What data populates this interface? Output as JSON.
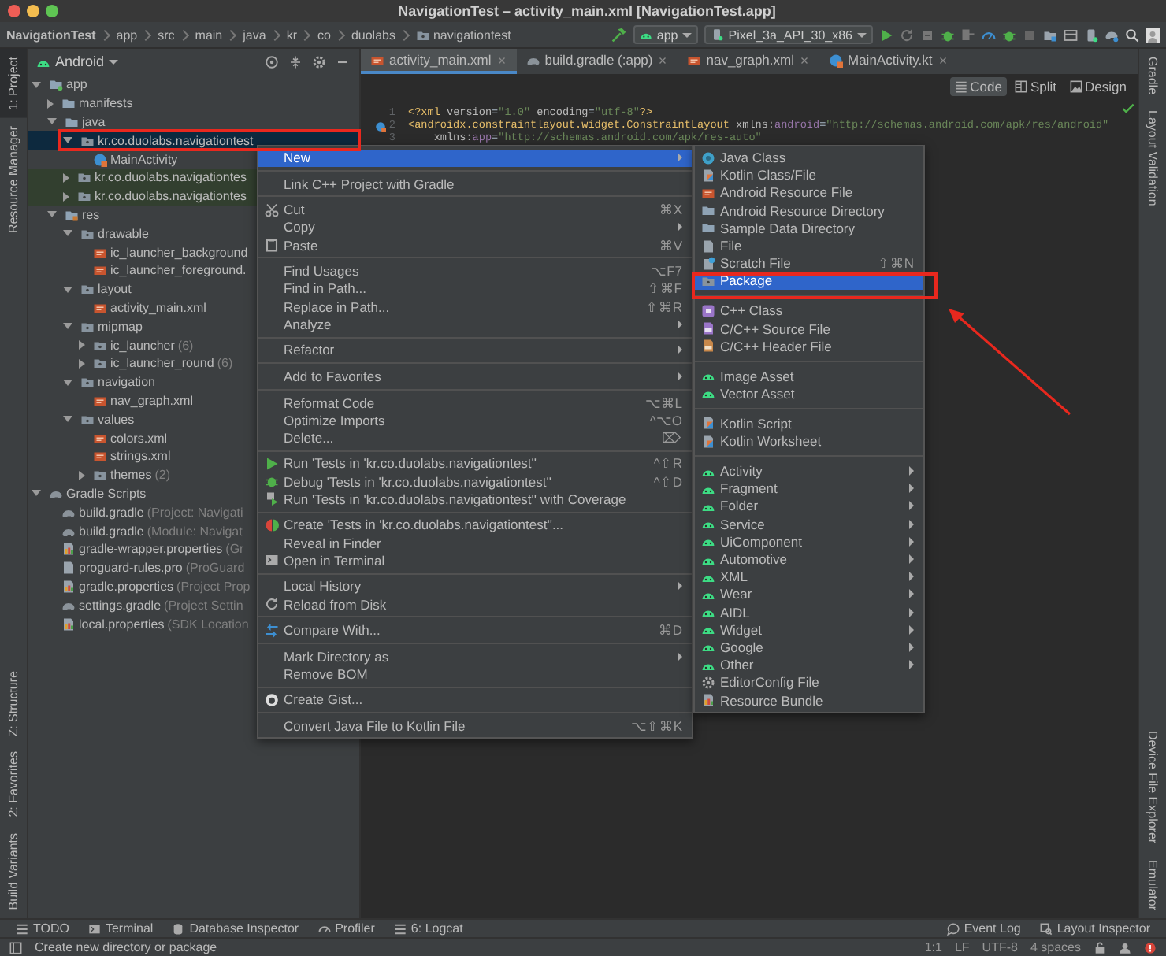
{
  "window": {
    "title": "NavigationTest – activity_main.xml [NavigationTest.app]"
  },
  "breadcrumbs": [
    {
      "label": "NavigationTest",
      "kind": "project"
    },
    {
      "label": "app",
      "kind": "plain"
    },
    {
      "label": "src",
      "kind": "plain"
    },
    {
      "label": "main",
      "kind": "plain"
    },
    {
      "label": "java",
      "kind": "plain"
    },
    {
      "label": "kr",
      "kind": "plain"
    },
    {
      "label": "co",
      "kind": "plain"
    },
    {
      "label": "duolabs",
      "kind": "plain"
    },
    {
      "label": "navigationtest",
      "kind": "folder"
    }
  ],
  "run_config": {
    "module": "app",
    "device": "Pixel_3a_API_30_x86"
  },
  "left_tool_tabs": {
    "top": [
      {
        "label": "1: Project",
        "selected": true
      },
      {
        "label": "Resource Manager",
        "selected": false
      }
    ],
    "bottom": [
      {
        "label": "Z: Structure",
        "selected": false
      },
      {
        "label": "2: Favorites",
        "selected": false
      },
      {
        "label": "Build Variants",
        "selected": false
      }
    ]
  },
  "right_tool_tabs": {
    "top": [
      {
        "label": "Gradle"
      },
      {
        "label": "Layout Validation"
      }
    ],
    "bottom": [
      {
        "label": "Device File Explorer"
      },
      {
        "label": "Emulator"
      }
    ]
  },
  "project_panel": {
    "view": "Android",
    "tree": [
      {
        "label": "app",
        "kind": "module",
        "expanded": true,
        "selected": false,
        "children": [
          {
            "label": "manifests",
            "kind": "folder",
            "expanded": false,
            "selected": false
          },
          {
            "label": "java",
            "kind": "folder",
            "expanded": true,
            "selected": false,
            "children": [
              {
                "label": "kr.co.duolabs.navigationtest",
                "kind": "package",
                "expanded": true,
                "selected": true,
                "outlined": true,
                "children": [
                  {
                    "label": "MainActivity",
                    "kind": "kotlin-class",
                    "selected": false
                  }
                ]
              },
              {
                "label": "kr.co.duolabs.navigationtes",
                "kind": "test-package",
                "expanded": false,
                "selected": false
              },
              {
                "label": "kr.co.duolabs.navigationtes",
                "kind": "test-package",
                "expanded": false,
                "selected": false
              }
            ]
          },
          {
            "label": "res",
            "kind": "res",
            "expanded": true,
            "selected": false,
            "children": [
              {
                "label": "drawable",
                "kind": "package",
                "expanded": true,
                "selected": false,
                "children": [
                  {
                    "label": "ic_launcher_background",
                    "kind": "xml",
                    "selected": false
                  },
                  {
                    "label": "ic_launcher_foreground.",
                    "kind": "xml",
                    "selected": false
                  }
                ]
              },
              {
                "label": "layout",
                "kind": "package",
                "expanded": true,
                "selected": false,
                "children": [
                  {
                    "label": "activity_main.xml",
                    "kind": "xml",
                    "selected": false
                  }
                ]
              },
              {
                "label": "mipmap",
                "kind": "package",
                "expanded": true,
                "selected": false,
                "children": [
                  {
                    "label": "ic_launcher",
                    "hint": "(6)",
                    "kind": "package",
                    "expanded": false,
                    "selected": false
                  },
                  {
                    "label": "ic_launcher_round",
                    "hint": "(6)",
                    "kind": "package",
                    "expanded": false,
                    "selected": false
                  }
                ]
              },
              {
                "label": "navigation",
                "kind": "package",
                "expanded": true,
                "selected": false,
                "children": [
                  {
                    "label": "nav_graph.xml",
                    "kind": "xml",
                    "selected": false
                  }
                ]
              },
              {
                "label": "values",
                "kind": "package",
                "expanded": true,
                "selected": false,
                "children": [
                  {
                    "label": "colors.xml",
                    "kind": "xml",
                    "selected": false
                  },
                  {
                    "label": "strings.xml",
                    "kind": "xml",
                    "selected": false
                  },
                  {
                    "label": "themes",
                    "hint": "(2)",
                    "kind": "package",
                    "expanded": false,
                    "selected": false
                  }
                ]
              }
            ]
          }
        ]
      },
      {
        "label": "Gradle Scripts",
        "kind": "gradle",
        "expanded": true,
        "selected": false,
        "children": [
          {
            "label": "build.gradle",
            "hint": "(Project: Navigati",
            "kind": "gradle",
            "selected": false
          },
          {
            "label": "build.gradle",
            "hint": "(Module: Navigat",
            "kind": "gradle",
            "selected": false
          },
          {
            "label": "gradle-wrapper.properties",
            "hint": "(Gr",
            "kind": "properties",
            "selected": false
          },
          {
            "label": "proguard-rules.pro",
            "hint": "(ProGuard",
            "kind": "file",
            "selected": false
          },
          {
            "label": "gradle.properties",
            "hint": "(Project Prop",
            "kind": "properties",
            "selected": false
          },
          {
            "label": "settings.gradle",
            "hint": "(Project Settin",
            "kind": "gradle",
            "selected": false
          },
          {
            "label": "local.properties",
            "hint": "(SDK Location",
            "kind": "properties",
            "selected": false
          }
        ]
      }
    ]
  },
  "editor": {
    "tabs": [
      {
        "label": "activity_main.xml",
        "kind": "xml",
        "selected": true
      },
      {
        "label": "build.gradle (:app)",
        "kind": "gradle",
        "selected": false
      },
      {
        "label": "nav_graph.xml",
        "kind": "xml",
        "selected": false
      },
      {
        "label": "MainActivity.kt",
        "kind": "kotlin-class",
        "selected": false
      }
    ],
    "view_modes": [
      {
        "label": "Code",
        "selected": true
      },
      {
        "label": "Split",
        "selected": false
      },
      {
        "label": "Design",
        "selected": false
      }
    ],
    "lines": [
      {
        "number": "1",
        "tokens": [
          {
            "text": "<?xml ",
            "kind": "tag"
          },
          {
            "text": "version",
            "kind": "attr"
          },
          {
            "text": "=",
            "kind": "plain"
          },
          {
            "text": "\"1.0\"",
            "kind": "value"
          },
          {
            "text": " encoding",
            "kind": "attr"
          },
          {
            "text": "=",
            "kind": "plain"
          },
          {
            "text": "\"utf-8\"",
            "kind": "value"
          },
          {
            "text": "?>",
            "kind": "tag"
          }
        ]
      },
      {
        "number": "2",
        "tokens": [
          {
            "text": "<androidx.constraintlayout.widget.ConstraintLayout ",
            "kind": "tag"
          },
          {
            "text": "xmlns:",
            "kind": "attr"
          },
          {
            "text": "android",
            "kind": "ns"
          },
          {
            "text": "=",
            "kind": "plain"
          },
          {
            "text": "\"http://schemas.android.com/apk/res/android\"",
            "kind": "value"
          }
        ]
      },
      {
        "number": "3",
        "tokens": [
          {
            "text": "    xmlns:",
            "kind": "attr"
          },
          {
            "text": "app",
            "kind": "ns"
          },
          {
            "text": "=",
            "kind": "plain"
          },
          {
            "text": "\"http://schemas.android.com/apk/res-auto\"",
            "kind": "value"
          }
        ]
      }
    ]
  },
  "context_menu": {
    "groups": [
      [
        {
          "label": "New",
          "submenu": true,
          "selected": true
        }
      ],
      [
        {
          "label": "Link C++ Project with Gradle",
          "selected": false
        }
      ],
      [
        {
          "label": "Cut",
          "kind": "scissors",
          "shortcut": "⌘X",
          "selected": false
        },
        {
          "label": "Copy",
          "submenu": true,
          "selected": false
        },
        {
          "label": "Paste",
          "kind": "clipboard",
          "shortcut": "⌘V",
          "selected": false
        }
      ],
      [
        {
          "label": "Find Usages",
          "shortcut": "⌥F7",
          "selected": false
        },
        {
          "label": "Find in Path...",
          "shortcut": "⇧⌘F",
          "selected": false
        },
        {
          "label": "Replace in Path...",
          "shortcut": "⇧⌘R",
          "selected": false
        },
        {
          "label": "Analyze",
          "submenu": true,
          "selected": false
        }
      ],
      [
        {
          "label": "Refactor",
          "submenu": true,
          "selected": false
        }
      ],
      [
        {
          "label": "Add to Favorites",
          "submenu": true,
          "selected": false
        }
      ],
      [
        {
          "label": "Reformat Code",
          "shortcut": "⌥⌘L",
          "selected": false
        },
        {
          "label": "Optimize Imports",
          "shortcut": "^⌥O",
          "selected": false
        },
        {
          "label": "Delete...",
          "shortcut": "⌦",
          "selected": false
        }
      ],
      [
        {
          "label": "Run 'Tests in 'kr.co.duolabs.navigationtest''",
          "kind": "run",
          "shortcut": "^⇧R",
          "selected": false
        },
        {
          "label": "Debug 'Tests in 'kr.co.duolabs.navigationtest''",
          "kind": "debug",
          "shortcut": "^⇧D",
          "selected": false
        },
        {
          "label": "Run 'Tests in 'kr.co.duolabs.navigationtest'' with Coverage",
          "kind": "coverage",
          "selected": false
        }
      ],
      [
        {
          "label": "Create 'Tests in 'kr.co.duolabs.navigationtest''...",
          "kind": "test",
          "selected": false
        },
        {
          "label": "Reveal in Finder",
          "selected": false
        },
        {
          "label": "Open in Terminal",
          "kind": "terminal",
          "selected": false
        }
      ],
      [
        {
          "label": "Local History",
          "submenu": true,
          "selected": false
        },
        {
          "label": "Reload from Disk",
          "kind": "reload",
          "selected": false
        }
      ],
      [
        {
          "label": "Compare With...",
          "kind": "compare",
          "shortcut": "⌘D",
          "selected": false
        }
      ],
      [
        {
          "label": "Mark Directory as",
          "submenu": true,
          "selected": false
        },
        {
          "label": "Remove BOM",
          "selected": false
        }
      ],
      [
        {
          "label": "Create Gist...",
          "kind": "github",
          "selected": false
        }
      ],
      [
        {
          "label": "Convert Java File to Kotlin File",
          "shortcut": "⌥⇧⌘K",
          "selected": false
        }
      ]
    ]
  },
  "submenu": {
    "groups": [
      [
        {
          "label": "Java Class",
          "kind": "java-class",
          "selected": false
        },
        {
          "label": "Kotlin Class/File",
          "kind": "kotlin-file",
          "selected": false
        },
        {
          "label": "Android Resource File",
          "kind": "xml",
          "selected": false
        },
        {
          "label": "Android Resource Directory",
          "kind": "folder",
          "selected": false
        },
        {
          "label": "Sample Data Directory",
          "kind": "folder",
          "selected": false
        },
        {
          "label": "File",
          "kind": "file",
          "selected": false
        },
        {
          "label": "Scratch File",
          "kind": "scratch",
          "shortcut": "⇧⌘N",
          "selected": false
        },
        {
          "label": "Package",
          "kind": "package",
          "selected": true,
          "outlined": true
        }
      ],
      [
        {
          "label": "C++ Class",
          "kind": "cpp",
          "selected": false
        },
        {
          "label": "C/C++ Source File",
          "kind": "cpp-file",
          "selected": false
        },
        {
          "label": "C/C++ Header File",
          "kind": "header-file",
          "selected": false
        }
      ],
      [
        {
          "label": "Image Asset",
          "kind": "android",
          "selected": false
        },
        {
          "label": "Vector Asset",
          "kind": "android",
          "selected": false
        }
      ],
      [
        {
          "label": "Kotlin Script",
          "kind": "kotlin-file",
          "selected": false
        },
        {
          "label": "Kotlin Worksheet",
          "kind": "kotlin-file",
          "selected": false
        }
      ],
      [
        {
          "label": "Activity",
          "kind": "android",
          "submenu": true,
          "selected": false
        },
        {
          "label": "Fragment",
          "kind": "android",
          "submenu": true,
          "selected": false
        },
        {
          "label": "Folder",
          "kind": "android",
          "submenu": true,
          "selected": false
        },
        {
          "label": "Service",
          "kind": "android",
          "submenu": true,
          "selected": false
        },
        {
          "label": "UiComponent",
          "kind": "android",
          "submenu": true,
          "selected": false
        },
        {
          "label": "Automotive",
          "kind": "android",
          "submenu": true,
          "selected": false
        },
        {
          "label": "XML",
          "kind": "android",
          "submenu": true,
          "selected": false
        },
        {
          "label": "Wear",
          "kind": "android",
          "submenu": true,
          "selected": false
        },
        {
          "label": "AIDL",
          "kind": "android",
          "submenu": true,
          "selected": false
        },
        {
          "label": "Widget",
          "kind": "android",
          "submenu": true,
          "selected": false
        },
        {
          "label": "Google",
          "kind": "android",
          "submenu": true,
          "selected": false
        },
        {
          "label": "Other",
          "kind": "android",
          "submenu": true,
          "selected": false
        },
        {
          "label": "EditorConfig File",
          "kind": "gear",
          "selected": false
        },
        {
          "label": "Resource Bundle",
          "kind": "properties",
          "selected": false
        }
      ]
    ]
  },
  "bottom_tools": {
    "left": [
      {
        "label": "TODO",
        "kind": "list"
      },
      {
        "label": "Terminal",
        "kind": "terminal"
      },
      {
        "label": "Database Inspector",
        "kind": "database"
      },
      {
        "label": "Profiler",
        "kind": "gauge"
      },
      {
        "label": "6: Logcat",
        "kind": "list"
      }
    ],
    "right": [
      {
        "label": "Event Log",
        "kind": "balloon"
      },
      {
        "label": "Layout Inspector",
        "kind": "inspect"
      }
    ]
  },
  "status_bar": {
    "message": "Create new directory or package",
    "items": [
      "1:1",
      "LF",
      "UTF-8",
      "4 spaces"
    ]
  }
}
